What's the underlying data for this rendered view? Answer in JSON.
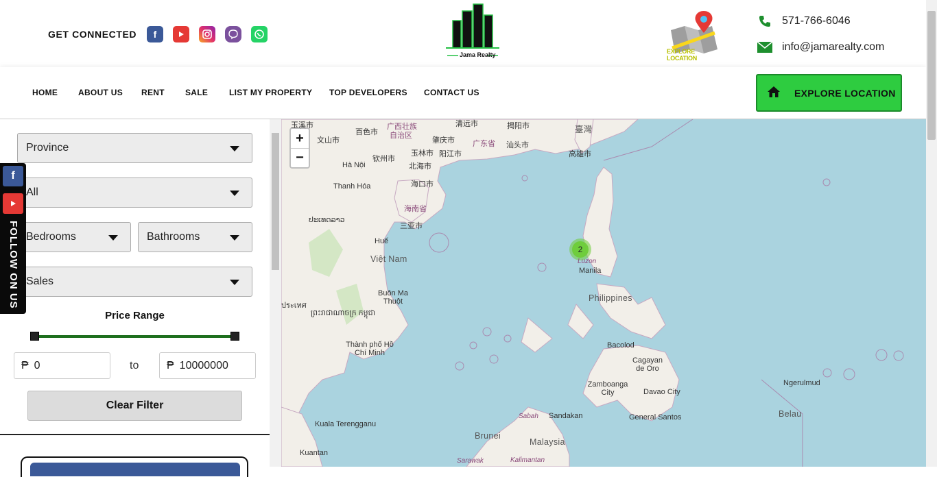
{
  "header": {
    "get_connected": "GET CONNECTED",
    "logo_text": "Jama Realty",
    "explore_badge_text": "EXPLORE LOCATION",
    "phone": "571-766-6046",
    "email": "info@jamarealty.com",
    "social_icons": [
      "facebook-icon",
      "youtube-icon",
      "instagram-icon",
      "viber-icon",
      "whatsapp-icon"
    ]
  },
  "nav": {
    "items": [
      "HOME",
      "ABOUT US",
      "RENT",
      "SALE",
      "LIST MY PROPERTY",
      "TOP DEVELOPERS",
      "CONTACT US"
    ],
    "explore_button": "EXPLORE LOCATION",
    "accent": "#2ecc40"
  },
  "filters": {
    "province": "Province",
    "city": "All",
    "bedrooms": "Bedrooms",
    "bathrooms": "Bathrooms",
    "listing_type": "Sales",
    "price_range_label": "Price Range",
    "currency_symbol": "₱",
    "price_min": "0",
    "price_max": "10000000",
    "to_label": "to",
    "clear_button": "Clear Filter"
  },
  "follow": {
    "label": "FOLLOW ON US",
    "icons": [
      "facebook-icon",
      "youtube-icon"
    ]
  },
  "map": {
    "zoom_in": "+",
    "zoom_out": "−",
    "cluster_count": "2",
    "labels": {
      "yuxi": "玉溪市",
      "wenshan": "文山市",
      "baise": "百色市",
      "guangxi": "广西壮族",
      "guangxi2": "自治区",
      "qingyuan": "清远市",
      "jieyang": "揭阳市",
      "taiwan": "臺灣",
      "zhaoqing": "肇庆市",
      "guangdong": "广东省",
      "shantou": "汕头市",
      "kaohsiung": "高雄市",
      "yulin": "玉林市",
      "yangjiang": "阳江市",
      "qinzhou": "钦州市",
      "beihai": "北海市",
      "hanoi": "Hà Nội",
      "haikou": "海口市",
      "thanhhoa": "Thanh Hóa",
      "hainan": "海南省",
      "sanya": "三亚市",
      "laos": "ປະເທດລາວ",
      "thai": "ประเทศ",
      "hue": "Huế",
      "vietnam": "Việt Nam",
      "luzon": "Luzon",
      "manila": "Manila",
      "philippines": "Philippines",
      "buonmathuot": "Buôn Ma Thuột",
      "cambodia": "ព្រះរាជាណាចក្រ កម្ពុជា",
      "hcmc": "Thành phố Hồ Chí Minh",
      "bacolod": "Bacolod",
      "cagayan": "Cagayan de Oro",
      "zamboanga": "Zamboanga City",
      "davao": "Davao City",
      "ngerulmud": "Ngerulmud",
      "belau": "Belau",
      "kualaterengganu": "Kuala Terengganu",
      "sabah": "Sabah",
      "sandakan": "Sandakan",
      "generalsantos": "General Santos",
      "brunei": "Brunei",
      "malaysia": "Malaysia",
      "kuantan": "Kuantan",
      "sarawak": "Sarawak",
      "kalimantan": "Kalimantan"
    }
  }
}
